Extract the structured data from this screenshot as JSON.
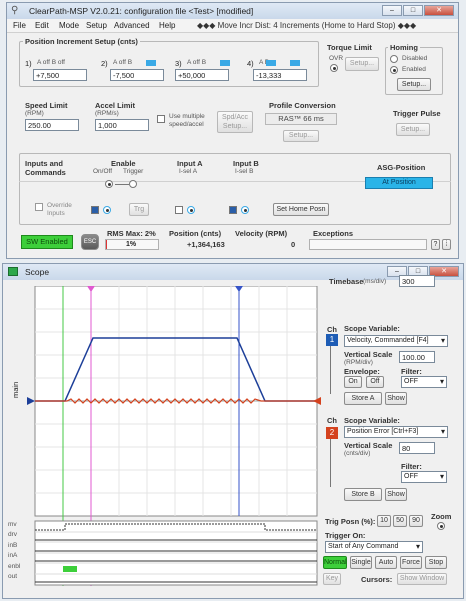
{
  "main_window": {
    "title": "ClearPath-MSP V2.0.21:  configuration file <Test> [modified]",
    "menu": [
      "File",
      "Edit",
      "Mode",
      "Setup",
      "Advanced",
      "Help"
    ],
    "menu_status": "◆◆◆ Move Incr Dist: 4 Increments (Home to Hard Stop) ◆◆◆",
    "pos_incr": {
      "title": "Position Increment Setup (cnts)",
      "items": [
        {
          "num": "1)",
          "label": "A off  B off",
          "value": "+7,500"
        },
        {
          "num": "2)",
          "label": "A off  B",
          "value": "-7,500"
        },
        {
          "num": "3)",
          "label": "A off  B",
          "value": "+50,000"
        },
        {
          "num": "4)",
          "label": "A      B",
          "value": "-13,333"
        }
      ]
    },
    "torque": {
      "title": "Torque Limit",
      "ovr": "OVR",
      "setup": "Setup..."
    },
    "homing": {
      "title": "Homing",
      "disabled": "Disabled",
      "enabled": "Enabled",
      "setup": "Setup..."
    },
    "speed": {
      "title": "Speed Limit",
      "unit": "(RPM)",
      "value": "250.00"
    },
    "accel": {
      "title": "Accel Limit",
      "unit": "(RPM/s)",
      "value": "1,000"
    },
    "multi": {
      "label": "Use multiple speed/accel",
      "btn": "Spd/Acc Setup..."
    },
    "profile": {
      "title": "Profile Conversion",
      "value": "RAS™ 66 ms",
      "setup": "Setup..."
    },
    "trigger": {
      "title": "Trigger Pulse",
      "setup": "Setup..."
    },
    "inputs": {
      "title": "Inputs and Commands",
      "enable": "Enable",
      "onoff": "On/Off",
      "trg": "Trigger",
      "inputA": "Input A",
      "iselA": "I-sel A",
      "inputB": "Input B",
      "iselB": "I-sel B",
      "override": "Override Inputs",
      "trg_btn": "Trg",
      "home_btn": "Set Home Posn"
    },
    "asg": {
      "title": "ASG-Position",
      "value": "At Position"
    },
    "status": {
      "sw_enabled": "SW Enabled",
      "esc": "ESC",
      "rms_label": "RMS Max: 2%",
      "rms_value": "1%",
      "pos_label": "Position (cnts)",
      "pos_value": "+1,364,163",
      "vel_label": "Velocity (RPM)",
      "vel_value": "0",
      "exc_label": "Exceptions",
      "help": "?"
    }
  },
  "scope_window": {
    "title": "Scope",
    "main_label": "main",
    "channels": [
      "mv",
      "drv",
      "inB",
      "inA",
      "enbl",
      "out"
    ],
    "timebase": {
      "label": "Timebase",
      "unit": "(ms/div)",
      "value": "300"
    },
    "ch1": {
      "ch": "Ch",
      "num": "1",
      "color": "#1d5cb5",
      "scope_var_label": "Scope Variable:",
      "scope_var": "Velocity, Commanded [F4]",
      "vscale_label": "Vertical Scale",
      "vscale_unit": "(RPM/div)",
      "vscale": "100.00",
      "envelope_label": "Envelope:",
      "on": "On",
      "off": "Off",
      "filter_label": "Filter:",
      "filter": "OFF",
      "store": "Store A",
      "show": "Show"
    },
    "ch2": {
      "ch": "Ch",
      "num": "2",
      "color": "#d4421e",
      "scope_var_label": "Scope Variable:",
      "scope_var": "Position Error [Ctrl+F3]",
      "vscale_label": "Vertical Scale",
      "vscale_unit": "(cnts/div)",
      "vscale": "80",
      "filter_label": "Filter:",
      "filter": "OFF",
      "store": "Store B",
      "show": "Show"
    },
    "trig": {
      "posn_label": "Trig Posn (%):",
      "p10": "10",
      "p50": "50",
      "p90": "90",
      "zoom": "Zoom",
      "on_label": "Trigger On:",
      "on_value": "Start of Any Command",
      "modes": [
        "Normal",
        "Single",
        "Auto",
        "Force",
        "Stop"
      ]
    },
    "key": "Key",
    "cursors": "Cursors:",
    "show_window": "Show Window"
  }
}
